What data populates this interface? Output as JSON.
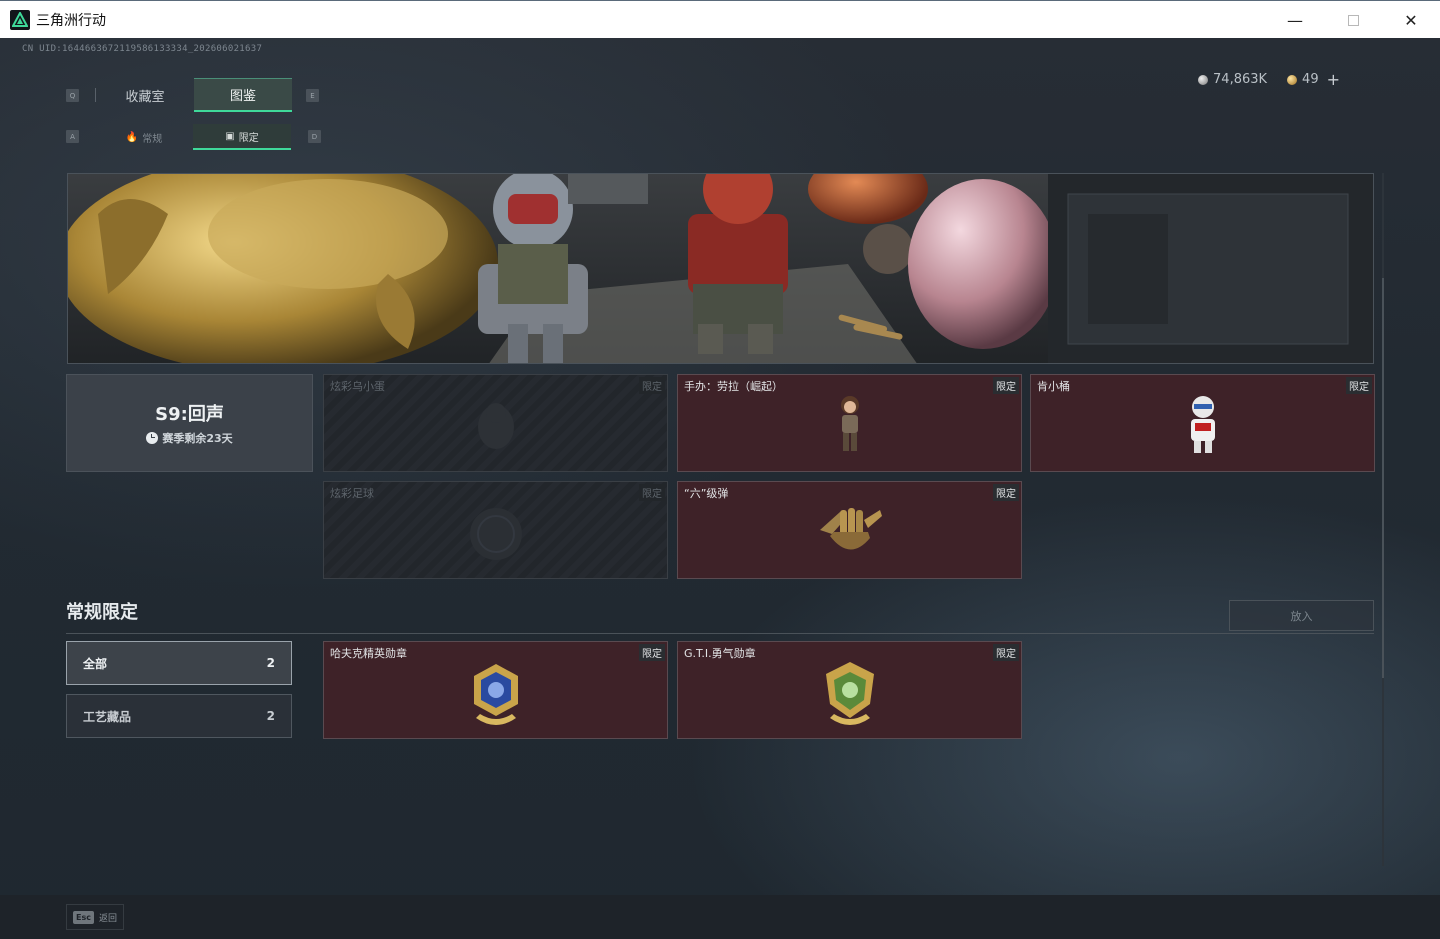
{
  "window": {
    "title": "三角洲行动",
    "minimize_glyph": "—",
    "close_glyph": "✕"
  },
  "game": {
    "uid": "CN UID:1644663672119586133334_202606021637",
    "currency": {
      "silver": "74,863K",
      "gold": "49",
      "plus": "+"
    },
    "keys": {
      "q": "Q",
      "e": "E",
      "a": "A",
      "d": "D"
    },
    "tabs": [
      {
        "label": "收藏室"
      },
      {
        "label": "图鉴"
      }
    ],
    "subtabs": [
      {
        "label": "常规"
      },
      {
        "label": "限定"
      }
    ],
    "season": {
      "title": "S9:回声",
      "remaining": "赛季剩余23天"
    },
    "season_cards": [
      {
        "name": "炫彩乌小蛋",
        "tag": "限定",
        "state": "locked"
      },
      {
        "name": "手办：劳拉（崛起）",
        "tag": "限定",
        "state": "owned"
      },
      {
        "name": "肯小桶",
        "tag": "限定",
        "state": "owned"
      },
      {
        "name": "炫彩足球",
        "tag": "限定",
        "state": "locked"
      },
      {
        "name": "“六”级弹",
        "tag": "限定",
        "state": "owned"
      }
    ],
    "section": {
      "title": "常规限定",
      "sort_label": "放入"
    },
    "filters": [
      {
        "label": "全部",
        "count": "2"
      },
      {
        "label": "工艺藏品",
        "count": "2"
      }
    ],
    "regular_cards": [
      {
        "name": "哈夫克精英勋章",
        "tag": "限定"
      },
      {
        "name": "G.T.I.勇气勋章",
        "tag": "限定"
      }
    ],
    "bottom": {
      "esc_key": "Esc",
      "esc_label": "返回"
    }
  },
  "colors": {
    "accent": "#3fd99a",
    "card_bg": "#3e2228",
    "background": "#1f2830"
  }
}
